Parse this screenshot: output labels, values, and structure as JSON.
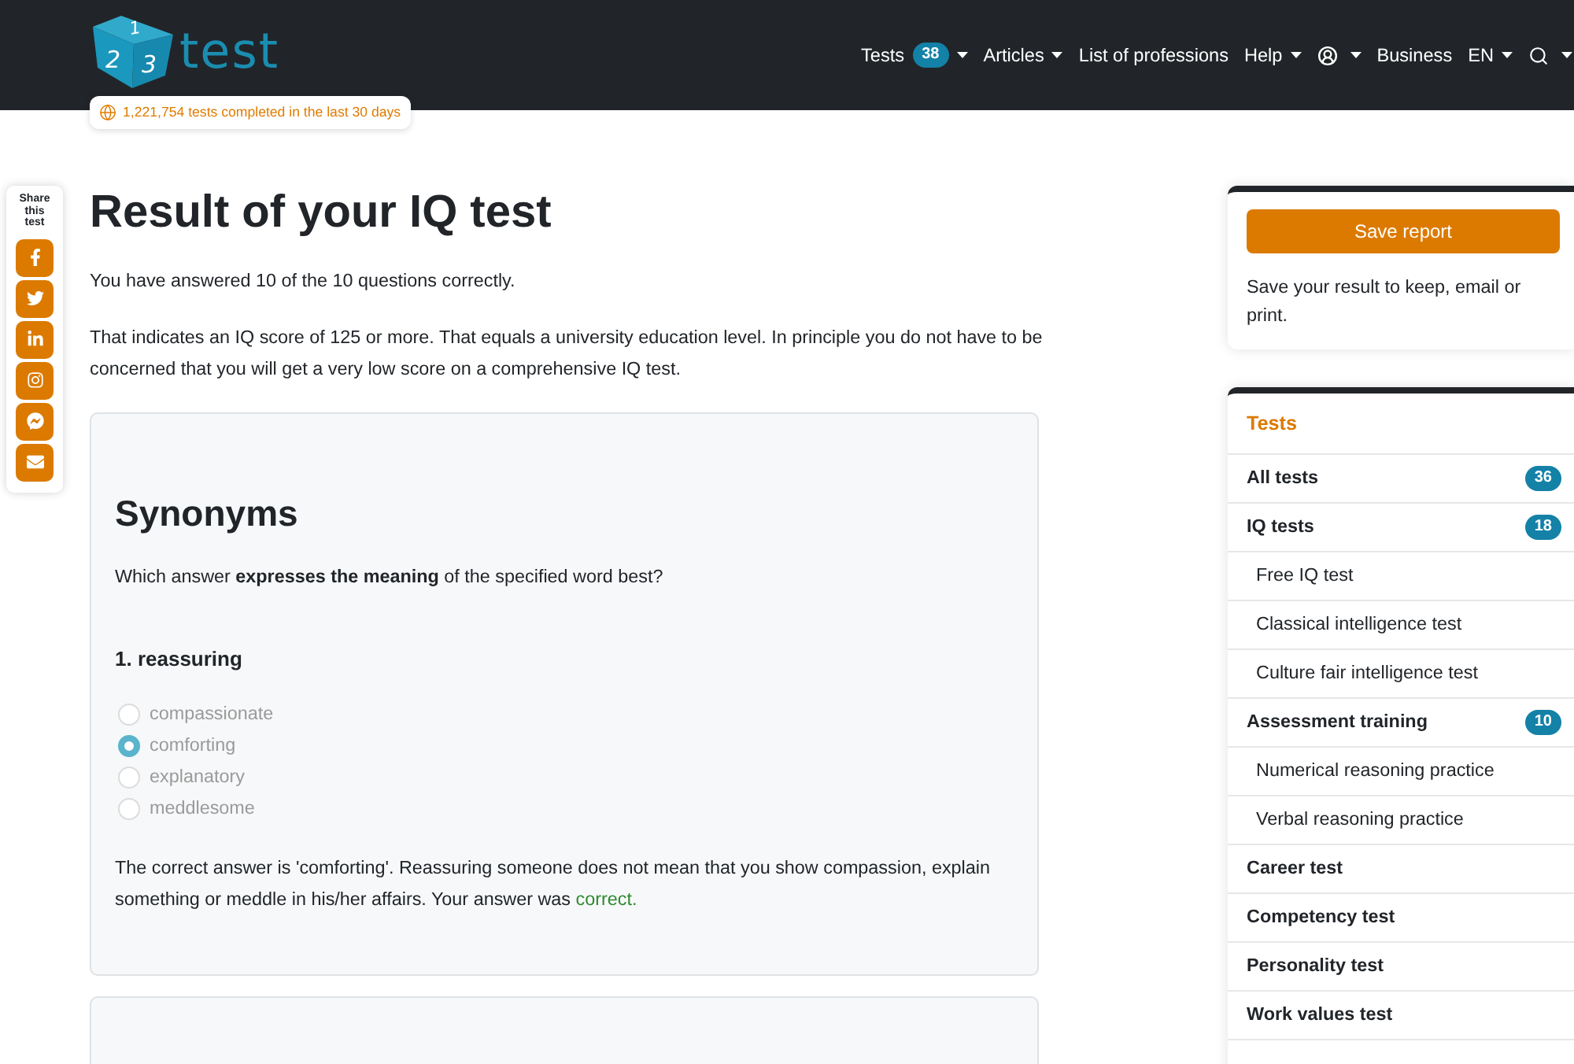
{
  "header": {
    "logo": {
      "cube_digits": [
        "1",
        "2",
        "3"
      ],
      "wordmark": "test"
    },
    "stats": "1,221,754 tests completed in the last 30 days",
    "nav": [
      {
        "kind": "menu",
        "label": "Tests",
        "count": "38",
        "dropdown": true
      },
      {
        "kind": "menu",
        "label": "Articles",
        "dropdown": true
      },
      {
        "kind": "menu",
        "label": "List of professions",
        "dropdown": false
      },
      {
        "kind": "menu",
        "label": "Help",
        "dropdown": true
      },
      {
        "kind": "account",
        "dropdown": true
      },
      {
        "kind": "menu",
        "label": "Business",
        "dropdown": false
      },
      {
        "kind": "menu",
        "label": "EN",
        "dropdown": true
      },
      {
        "kind": "search",
        "dropdown": true
      }
    ]
  },
  "share": {
    "title": "Share this test",
    "buttons": [
      {
        "kind": "facebook"
      },
      {
        "kind": "twitter"
      },
      {
        "kind": "linkedin"
      },
      {
        "kind": "instagram"
      },
      {
        "kind": "messenger"
      },
      {
        "kind": "email"
      }
    ]
  },
  "main": {
    "title": "Result of your IQ test",
    "paragraphs": [
      "You have answered 10 of the 10 questions correctly.",
      "That indicates an IQ score of 125 or more. That equals a university education level. In principle you do not have to be concerned that you will get a very low score on a comprehensive IQ test."
    ],
    "section": {
      "heading": "Synonyms",
      "instruction": "Which answer **expresses the meaning** of the specified word best?",
      "question": {
        "title": "1. reassuring",
        "options": [
          {
            "label": "compassionate",
            "selected": false
          },
          {
            "label": "comforting",
            "selected": true
          },
          {
            "label": "explanatory",
            "selected": false
          },
          {
            "label": "meddlesome",
            "selected": false
          }
        ],
        "explanation": "The correct answer is 'comforting'. Reassuring someone does not mean that you show compassion, explain something or meddle in his/her affairs. Your answer was",
        "verdict": "correct.",
        "answer_correct": true
      }
    }
  },
  "sidebar": {
    "save_card": {
      "button": "Save report",
      "text": "Save your result to keep, email or print."
    },
    "tests_menu": {
      "title": "Tests",
      "items": [
        {
          "label": "All tests",
          "count": "36"
        },
        {
          "label": "IQ tests",
          "count": "18",
          "children": [
            {
              "label": "Free IQ test"
            },
            {
              "label": "Classical intelligence test"
            },
            {
              "label": "Culture fair intelligence test"
            }
          ]
        },
        {
          "label": "Assessment training",
          "count": "10",
          "children": [
            {
              "label": "Numerical reasoning practice"
            },
            {
              "label": "Verbal reasoning practice"
            }
          ]
        },
        {
          "label": "Career test"
        },
        {
          "label": "Competency test"
        },
        {
          "label": "Personality test"
        },
        {
          "label": "Work values test"
        }
      ]
    }
  }
}
